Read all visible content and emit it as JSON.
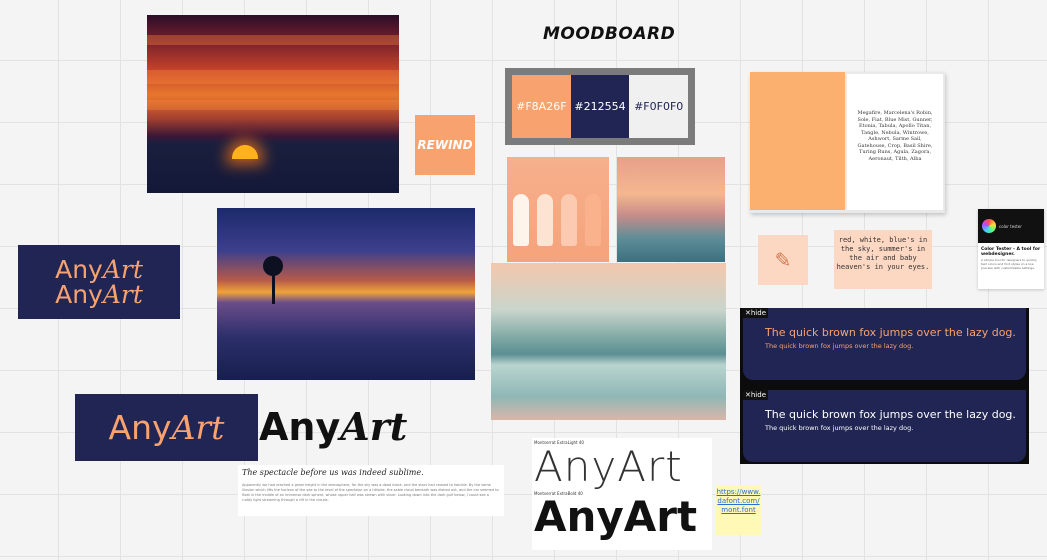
{
  "board": {
    "title": "MOODBOARD"
  },
  "rewind": {
    "label": "REWIND"
  },
  "palette": {
    "swatches": [
      {
        "hex": "#F8A26F",
        "color": "#F8A26F"
      },
      {
        "hex": "#212554",
        "color": "#212554"
      },
      {
        "hex": "#F0F0F0",
        "color": "#F0F0F0"
      }
    ]
  },
  "book": {
    "page_text": "Megafire, Marcelena's Robin, Sole, Fiat, Blue Mist, Gunner, Etonia, Tabula, Apollo Titan, Tangle, Nebula, Wintrowe, Ashwort, Sarme Sail, Gatehouse, Crop, Basil Shire, Turing Runs, Agula, Zagora, Aeronaut, Tilth, Alba"
  },
  "poem": {
    "text": "red, white, blue's in the sky, summer's in the air and baby heaven's in your eyes."
  },
  "app_card": {
    "hero_text": "color tester",
    "title": "Color Tester - A tool for webdesigner.",
    "body": "A simple tool for designers to quickly test colors and font styles on a live preview with customizable settings."
  },
  "anyart": {
    "tile1_line1_a": "Any",
    "tile1_line1_b": "Art",
    "tile1_line2_a": "Any",
    "tile1_line2_b": "Art",
    "tile2_a": "Any",
    "tile2_b": "Art",
    "black_a": "Any",
    "black_b": "Art"
  },
  "text_card": {
    "title": "The spectacle before us was indeed sublime.",
    "body": "Apparently we had reached a great height in the atmosphere, for the sky was a dead black, and the stars had ceased to twinkle. By the same illusion which lifts the horizon of the sea to the level of the spectator on a hillside, the sable cloud beneath was dished out, and the car seemed to float in the middle of an immense dark sphere, whose upper half was strewn with silver. Looking down into the dark gulf below, I could see a ruddy light streaming through a rift in the clouds."
  },
  "font_card": {
    "label1": "Montserrat ExtraLight 40",
    "thin": "AnyArt",
    "label2": "Montserrat ExtraBold 40",
    "heavy": "AnyArt"
  },
  "link_note": {
    "text": "https://www.dafont.com/mont.font"
  },
  "preview": {
    "hide_label": "✕hide",
    "sentence": "The quick brown fox jumps over the lazy dog."
  }
}
